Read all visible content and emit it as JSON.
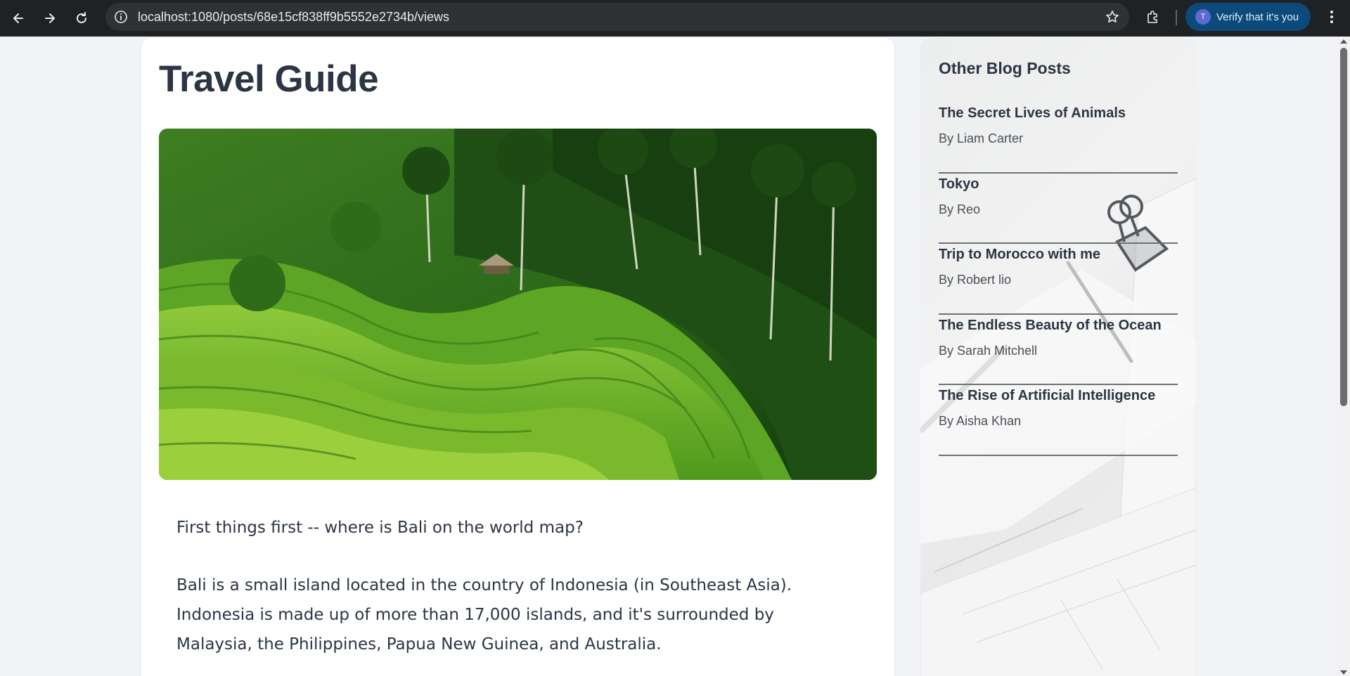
{
  "browser": {
    "url": "localhost:1080/posts/68e15cf838ff9b5552e2734b/views",
    "profile_initial": "T",
    "profile_label": "Verify that it's you",
    "icons": [
      "back-icon",
      "forward-icon",
      "reload-icon",
      "site-info-icon",
      "bookmark-star-icon",
      "extensions-icon",
      "menu-icon"
    ]
  },
  "article": {
    "title": "Travel Guide",
    "paragraphs": [
      "First things first -- where is Bali on the world map?",
      "Bali is a small island located in the country of Indonesia (in Southeast Asia). Indonesia is made up of more than 17,000 islands, and it's surrounded by Malaysia, the Philippines, Papua New Guinea, and Australia."
    ]
  },
  "sidebar": {
    "heading": "Other Blog Posts",
    "posts": [
      {
        "title": "The Secret Lives of Animals",
        "author": "By Liam Carter"
      },
      {
        "title": "Tokyo",
        "author": "By Reo"
      },
      {
        "title": "Trip to Morocco with me",
        "author": "By Robert lio"
      },
      {
        "title": "The Endless Beauty of the Ocean",
        "author": "By Sarah Mitchell"
      },
      {
        "title": "The Rise of Artificial Intelligence",
        "author": "By Aisha Khan"
      }
    ]
  },
  "colors": {
    "chrome_bg": "#202124",
    "omnibox_bg": "#303134",
    "profile_chip": "#0b4a7a",
    "text_primary": "#2b3544",
    "page_bg": "#f1f3f6"
  }
}
